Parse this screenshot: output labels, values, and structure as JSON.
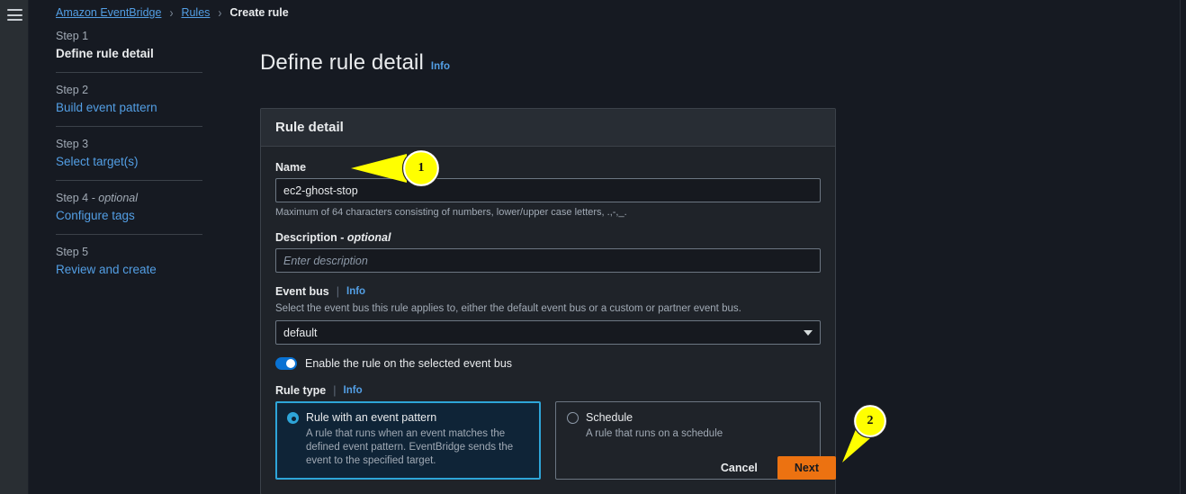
{
  "breadcrumb": {
    "items": [
      {
        "label": "Amazon EventBridge",
        "type": "link"
      },
      {
        "label": "Rules",
        "type": "link"
      },
      {
        "label": "Create rule",
        "type": "current"
      }
    ],
    "separator": "›"
  },
  "rail": {
    "menu_icon": "hamburger-menu-icon"
  },
  "wizard": {
    "steps": [
      {
        "num": "Step 1",
        "optional": "",
        "title": "Define rule detail",
        "active": true
      },
      {
        "num": "Step 2",
        "optional": "",
        "title": "Build event pattern",
        "active": false
      },
      {
        "num": "Step 3",
        "optional": "",
        "title": "Select target(s)",
        "active": false
      },
      {
        "num": "Step 4",
        "optional": " - optional",
        "title": "Configure tags",
        "active": false
      },
      {
        "num": "Step 5",
        "optional": "",
        "title": "Review and create",
        "active": false
      }
    ]
  },
  "page": {
    "title": "Define rule detail",
    "info_label": "Info"
  },
  "card": {
    "header": "Rule detail",
    "name": {
      "label": "Name",
      "value": "ec2-ghost-stop",
      "placeholder": "",
      "hint": "Maximum of 64 characters consisting of numbers, lower/upper case letters, .,-,_."
    },
    "description": {
      "label": "Description - ",
      "optional": "optional",
      "value": "",
      "placeholder": "Enter description"
    },
    "event_bus": {
      "label": "Event bus",
      "info_label": "Info",
      "desc": "Select the event bus this rule applies to, either the default event bus or a custom or partner event bus.",
      "selected": "default",
      "options": [
        "default"
      ]
    },
    "enable_toggle": {
      "label": "Enable the rule on the selected event bus",
      "on": true
    },
    "rule_type": {
      "label": "Rule type",
      "info_label": "Info",
      "options": [
        {
          "title": "Rule with an event pattern",
          "desc": "A rule that runs when an event matches the defined event pattern. EventBridge sends the event to the specified target.",
          "selected": true
        },
        {
          "title": "Schedule",
          "desc": "A rule that runs on a schedule",
          "selected": false
        }
      ]
    }
  },
  "actions": {
    "cancel": "Cancel",
    "next": "Next"
  },
  "annotations": [
    {
      "number": "1",
      "target": "name-input"
    },
    {
      "number": "2",
      "target": "next-button"
    }
  ],
  "colors": {
    "accent_link": "#539fe5",
    "primary_button": "#ec7211",
    "toggle_on": "#0972d3",
    "selected_tile_border": "#2ea5d8",
    "annotation": "#ffff00"
  }
}
